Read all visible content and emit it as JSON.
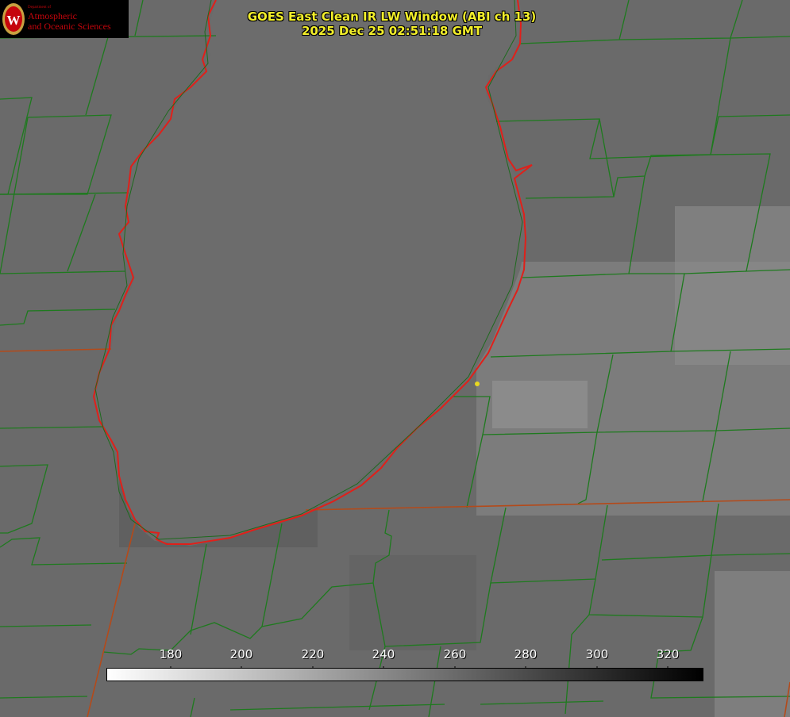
{
  "header": {
    "title_line1": "GOES East Clean IR LW Window (ABI ch 13)",
    "title_line2": "2025 Dec 25 02:51:18 GMT"
  },
  "logo": {
    "department": "Department of",
    "name_line1": "Atmospheric",
    "name_line2": "and Oceanic Sciences",
    "color": "#c5050c"
  },
  "colorbar": {
    "ticks": [
      "180",
      "200",
      "220",
      "240",
      "260",
      "280",
      "300",
      "320"
    ],
    "gradient": [
      "#ffffff",
      "#000000"
    ]
  },
  "colors": {
    "county_lines": "#1e7a1e",
    "shoreline": "#e0201a",
    "state_line": "#b44a1a",
    "title": "#f2ee2a",
    "point_marker": "#e8d820"
  }
}
